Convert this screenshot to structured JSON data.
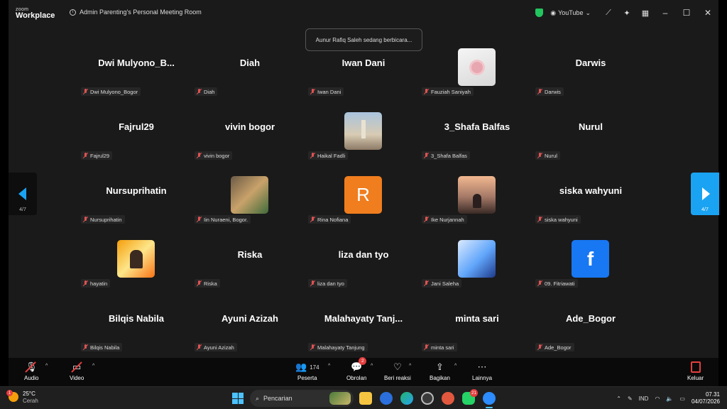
{
  "app": {
    "brand_small": "zoom",
    "brand_main": "Workplace"
  },
  "titlebar": {
    "meeting_title": "Admin Parenting's Personal Meeting Room",
    "youtube_label": "YouTube",
    "icons": [
      "shield-icon",
      "broadcast-icon",
      "magic-wand-icon",
      "sparkle-icon",
      "grid-icon"
    ],
    "window_controls": {
      "minimize": "–",
      "maximize": "☐",
      "close": "✕"
    }
  },
  "toast": {
    "text": "Aunur Rafiq Saleh sedang berbicara..."
  },
  "tiles": [
    {
      "display": "Dwi  Mulyono_B...",
      "label": "Dwi Mulyono_Bogor"
    },
    {
      "display": "Diah",
      "label": "Diah"
    },
    {
      "display": "Iwan Dani",
      "label": "Iwan Dani"
    },
    {
      "avatar": "rose",
      "label": "Fauziah Saniyah"
    },
    {
      "display": "Darwis",
      "label": "Darwis"
    },
    {
      "display": "Fajrul29",
      "label": "Fajrul29"
    },
    {
      "display": "vivin bogor",
      "label": "vivin bogor"
    },
    {
      "avatar": "mosque",
      "label": "Haikal Fadli"
    },
    {
      "display": "3_Shafa Balfas",
      "label": "3_Shafa Balfas"
    },
    {
      "display": "Nurul",
      "label": "Nurul"
    },
    {
      "display": "Nursuprihatin",
      "label": "Nursuprihatin"
    },
    {
      "avatar": "kids",
      "label": "Iin Nuraeni, Bogor."
    },
    {
      "avatar": "letter",
      "letter": "R",
      "label": "Rina Nofiana"
    },
    {
      "avatar": "sunset",
      "label": "Ike Nurjannah"
    },
    {
      "display": "siska wahyuni",
      "label": "siska wahyuni"
    },
    {
      "avatar": "promo",
      "label": "hayatin"
    },
    {
      "display": "Riska",
      "label": "Riska"
    },
    {
      "display": "liza dan tyo",
      "label": "liza dan tyo"
    },
    {
      "avatar": "class",
      "label": "Jani Saleha"
    },
    {
      "avatar": "facebook",
      "letter": "f",
      "label": "09. Fitriawati"
    },
    {
      "display": "Bilqis Nabila",
      "label": "Bilqis Nabila"
    },
    {
      "display": "Ayuni Azizah",
      "label": "Ayuni Azizah"
    },
    {
      "display": "Malahayaty  Tanj...",
      "label": "Malahayaty Tanjung"
    },
    {
      "display": "minta sari",
      "label": "minta sari"
    },
    {
      "display": "Ade_Bogor",
      "label": "Ade_Bogor"
    }
  ],
  "pagination": {
    "left": "4/7",
    "right": "4/7"
  },
  "toolbar": {
    "audio": "Audio",
    "video": "Video",
    "participants": "Peserta",
    "participants_count": "174",
    "chat": "Obrolan",
    "chat_badge": "2",
    "reactions": "Beri reaksi",
    "share": "Bagikan",
    "more": "Lainnya",
    "leave": "Keluar"
  },
  "taskbar": {
    "weather_temp": "25°C",
    "weather_desc": "Cerah",
    "weather_badge": "1",
    "search_placeholder": "Pencarian",
    "whatsapp_badge": "21",
    "language": "IND",
    "time": "07.31",
    "date": "04/07/2026"
  },
  "colors": {
    "accent_blue": "#1aa3f2",
    "muted_red": "#e05252",
    "avatar_orange": "#f07d1e",
    "facebook_blue": "#1877f2"
  }
}
